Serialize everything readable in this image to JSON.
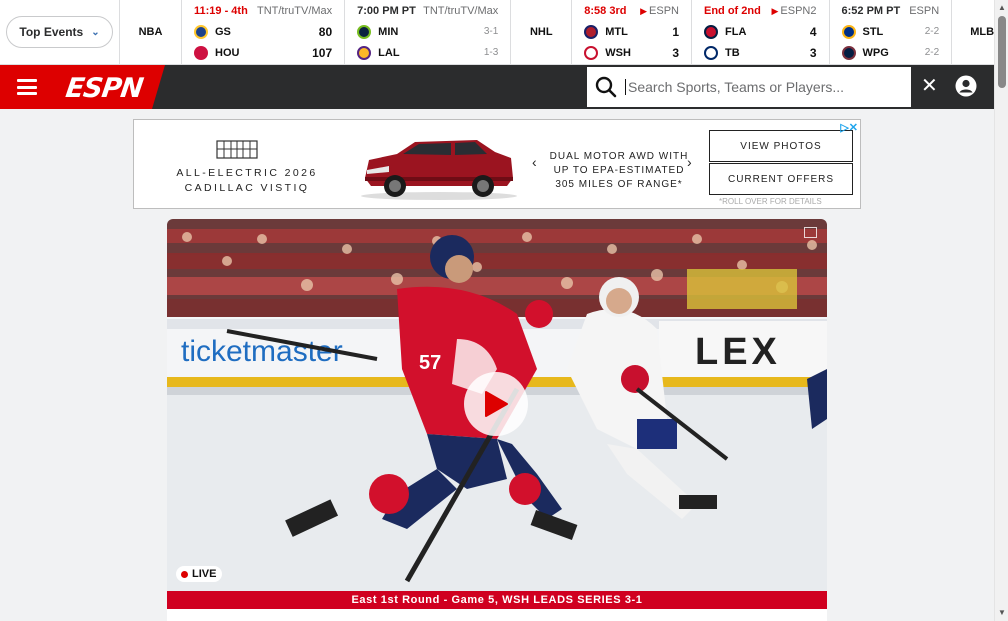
{
  "scoreboard": {
    "top_events_label": "Top Events",
    "leagues": {
      "nba": "NBA",
      "nhl": "NHL",
      "mlb": "MLB"
    },
    "games": [
      {
        "status": "11:19 - 4th",
        "network": "TNT/truTV/Max",
        "live": true,
        "net_live": false,
        "teams": [
          {
            "abbr": "GS",
            "value": "80",
            "color": "#1d428a"
          },
          {
            "abbr": "HOU",
            "value": "107",
            "color": "#ce1141"
          }
        ]
      },
      {
        "status": "7:00 PM PT",
        "network": "TNT/truTV/Max",
        "live": false,
        "net_live": false,
        "teams": [
          {
            "abbr": "MIN",
            "value": "3-1",
            "color": "#0c2340"
          },
          {
            "abbr": "LAL",
            "value": "1-3",
            "color": "#fdb927"
          }
        ]
      },
      {
        "status": "8:58 3rd",
        "network": "ESPN",
        "live": true,
        "net_live": true,
        "teams": [
          {
            "abbr": "MTL",
            "value": "1",
            "color": "#af1e2d"
          },
          {
            "abbr": "WSH",
            "value": "3",
            "color": "#c8102e"
          }
        ]
      },
      {
        "status": "End of 2nd",
        "network": "ESPN2",
        "live": true,
        "net_live": true,
        "teams": [
          {
            "abbr": "FLA",
            "value": "4",
            "color": "#c8102e"
          },
          {
            "abbr": "TB",
            "value": "3",
            "color": "#002868"
          }
        ]
      },
      {
        "status": "6:52 PM PT",
        "network": "ESPN",
        "live": false,
        "net_live": false,
        "teams": [
          {
            "abbr": "STL",
            "value": "2-2",
            "color": "#002f87"
          },
          {
            "abbr": "WPG",
            "value": "2-2",
            "color": "#041e42"
          }
        ]
      }
    ]
  },
  "nav": {
    "logo_text": "ESPN",
    "search_placeholder": "Search Sports, Teams or Players...",
    "close_glyph": "✕"
  },
  "ad": {
    "brand_line1": "ALL-ELECTRIC 2026",
    "brand_line2": "CADILLAC VISTIQ",
    "tagline_l1": "DUAL MOTOR AWD WITH",
    "tagline_l2": "UP TO EPA-ESTIMATED",
    "tagline_l3": "305 MILES OF RANGE*",
    "btn_photos": "VIEW PHOTOS",
    "btn_offers": "CURRENT OFFERS",
    "fine_print": "*ROLL OVER FOR DETAILS",
    "adchoices": "▷✕"
  },
  "hero": {
    "live_label": "LIVE",
    "caption": "East 1st Round - Game 5, WSH LEADS SERIES 3-1",
    "jersey_number": "57",
    "board_text_1": "ticketmaster",
    "board_text_2": "LEX"
  },
  "colors": {
    "espn_red": "#dd0000",
    "nav_dark": "#2b2c2d",
    "caption_red": "#d00020"
  }
}
